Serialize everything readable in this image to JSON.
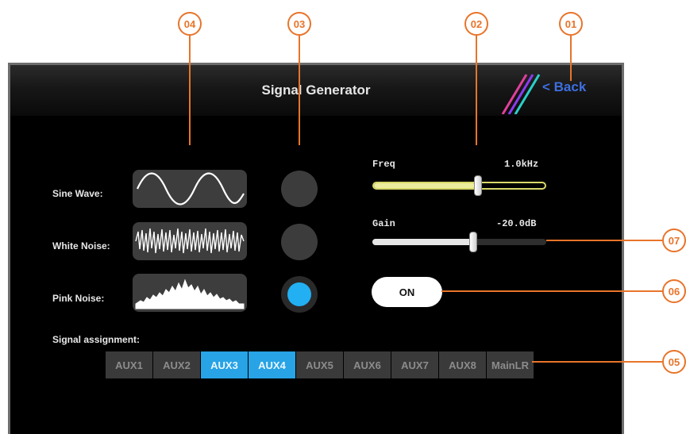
{
  "callouts": [
    "01",
    "02",
    "03",
    "04",
    "05",
    "06",
    "07"
  ],
  "header": {
    "title": "Signal Generator",
    "back_label": "< Back"
  },
  "signals": [
    {
      "label": "Sine Wave:",
      "icon": "sine-wave-icon",
      "selected": false
    },
    {
      "label": "White Noise:",
      "icon": "white-noise-icon",
      "selected": false
    },
    {
      "label": "Pink Noise:",
      "icon": "pink-noise-icon",
      "selected": true
    }
  ],
  "freq": {
    "label": "Freq",
    "value": "1.0kHz",
    "level": 0.6
  },
  "gain": {
    "label": "Gain",
    "value": "-20.0dB",
    "level": 0.58
  },
  "on_button": {
    "label": "ON"
  },
  "assignment": {
    "label": "Signal assignment:",
    "buses": [
      {
        "label": "AUX1",
        "active": false
      },
      {
        "label": "AUX2",
        "active": false
      },
      {
        "label": "AUX3",
        "active": true
      },
      {
        "label": "AUX4",
        "active": true
      },
      {
        "label": "AUX5",
        "active": false
      },
      {
        "label": "AUX6",
        "active": false
      },
      {
        "label": "AUX7",
        "active": false
      },
      {
        "label": "AUX8",
        "active": false
      },
      {
        "label": "MainLR",
        "active": false
      }
    ]
  },
  "colors": {
    "accent": "#22b0f2",
    "callout": "#e8742a",
    "freq_track": "#e9e9a0",
    "back": "#3d6fe0"
  }
}
